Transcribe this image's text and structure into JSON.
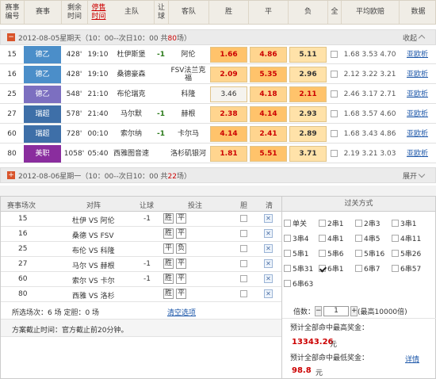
{
  "header": {
    "match_no": "赛事\n编号",
    "league": "赛事",
    "remain": "剩余\n时间",
    "deadline": "停售\n时间",
    "home": "主队",
    "handicap": "让\n球",
    "away": "客队",
    "win": "胜",
    "draw": "平",
    "lose": "负",
    "all": "全",
    "avg_odds": "平均欧赔",
    "data": "数据"
  },
  "day1": {
    "date": "2012-08-05星期天",
    "range": "（10：00--次日10：00 共",
    "count": "80",
    "unit": "场）",
    "toggle": "收起"
  },
  "day2": {
    "date": "2012-08-06星期一",
    "range": "（10：00--次日10：00 共",
    "count": "22",
    "unit": "场）",
    "toggle": "展开"
  },
  "matches": [
    {
      "no": "15",
      "league": "德乙",
      "lcolor": "#4b8ec9",
      "remain": "428'",
      "time": "19:10",
      "home": "杜伊斯堡",
      "hc": "-1",
      "away": "阿伦",
      "w": "1.66",
      "d": "4.86",
      "l": "5.11",
      "odds": "1.68 3.53 4.70",
      "link": "亚欧析"
    },
    {
      "no": "16",
      "league": "德乙",
      "lcolor": "#4b8ec9",
      "remain": "428'",
      "time": "19:10",
      "home": "桑德豪森",
      "hc": "",
      "away": "FSV法兰克福",
      "w": "2.09",
      "d": "5.35",
      "l": "2.96",
      "odds": "2.12 3.22 3.21",
      "link": "亚欧析"
    },
    {
      "no": "25",
      "league": "德乙",
      "lcolor": "#7c6fc0",
      "remain": "548'",
      "time": "21:10",
      "home": "布伦瑞克",
      "hc": "",
      "away": "科隆",
      "w": "3.46",
      "d": "4.18",
      "l": "2.11",
      "odds": "2.46 3.17 2.71",
      "link": "亚欧析"
    },
    {
      "no": "27",
      "league": "瑞超",
      "lcolor": "#3e6fa8",
      "remain": "578'",
      "time": "21:40",
      "home": "马尔默",
      "hc": "-1",
      "away": "赫根",
      "w": "2.38",
      "d": "4.14",
      "l": "2.93",
      "odds": "1.68 3.57 4.60",
      "link": "亚欧析"
    },
    {
      "no": "60",
      "league": "瑞超",
      "lcolor": "#3e6fa8",
      "remain": "728'",
      "time": "00:10",
      "home": "索尔纳",
      "hc": "-1",
      "away": "卡尔马",
      "w": "4.14",
      "d": "2.41",
      "l": "2.89",
      "odds": "1.68 3.43 4.86",
      "link": "亚欧析"
    },
    {
      "no": "80",
      "league": "美职",
      "lcolor": "#8a2d9e",
      "remain": "1058'",
      "time": "05:40",
      "home": "西雅图音速",
      "hc": "",
      "away": "洛杉矶银河",
      "w": "1.81",
      "d": "5.51",
      "l": "3.71",
      "odds": "2.19 3.21 3.03",
      "link": "亚欧析"
    }
  ],
  "bets": {
    "headers": {
      "no": "赛事场次",
      "match": "对阵",
      "hc": "让球",
      "pick": "投注",
      "dan": "胆",
      "clear": "清"
    },
    "rows": [
      {
        "no": "15",
        "match": "杜伊 VS 阿伦",
        "hc": "-1",
        "p1": "胜",
        "p2": "平"
      },
      {
        "no": "16",
        "match": "桑德 VS FSV",
        "hc": "",
        "p1": "胜",
        "p2": "平"
      },
      {
        "no": "25",
        "match": "布伦 VS 科隆",
        "hc": "",
        "p1": "平",
        "p2": "负"
      },
      {
        "no": "27",
        "match": "马尔 VS 赫根",
        "hc": "-1",
        "p1": "胜",
        "p2": "平"
      },
      {
        "no": "60",
        "match": "索尔 VS 卡尔",
        "hc": "-1",
        "p1": "胜",
        "p2": "平"
      },
      {
        "no": "80",
        "match": "西雅 VS 洛杉",
        "hc": "",
        "p1": "胜",
        "p2": "平"
      }
    ],
    "summary": "所选场次：6 场 定胆：0 场",
    "clear_all": "清空选项",
    "deadline": "方案截止时间：官方截止前20分钟。"
  },
  "pass": {
    "title": "过关方式",
    "options": [
      "单关",
      "2串1",
      "2串3",
      "3串1",
      "3串4",
      "4串1",
      "4串5",
      "4串11",
      "5串1",
      "5串6",
      "5串16",
      "5串26",
      "5串31",
      "6串1",
      "6串7",
      "6串57",
      "6串63"
    ],
    "multiplier_label": "倍数：",
    "multiplier": "1",
    "multiplier_max": "(最高10000倍)",
    "max_label": "预计全部命中最高奖金：",
    "max_value": "13343.26",
    "min_label": "预计全部命中最低奖金：",
    "min_value": "98.8",
    "yuan": "元",
    "detail": "详情"
  }
}
